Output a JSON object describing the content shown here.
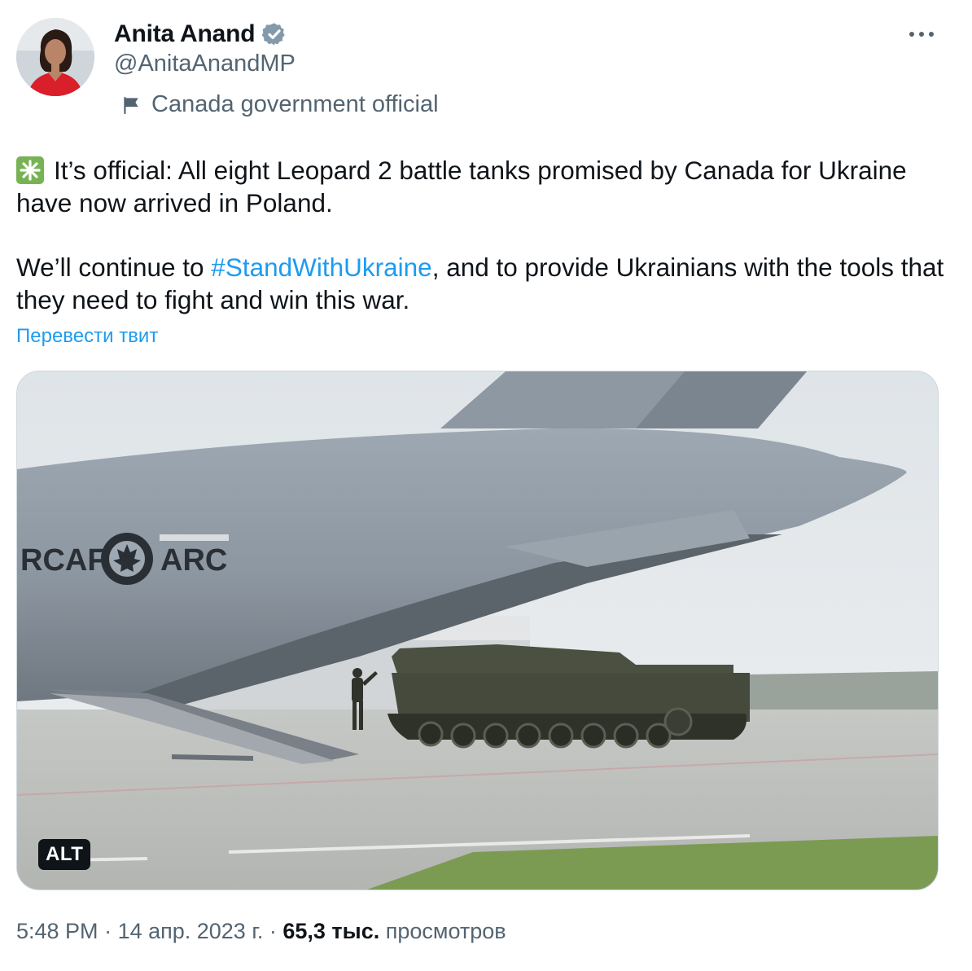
{
  "author": {
    "name": "Anita Anand",
    "handle": "@AnitaAnandMP",
    "label": "Canada government official",
    "verified_icon": "verified-badge-icon",
    "label_icon": "flag-icon"
  },
  "tweet": {
    "line1_text": "It’s official: All eight Leopard 2 battle tanks promised by Canada for Ukraine have now arrived in Poland.",
    "line2_before": "We’ll continue to ",
    "hashtag": "#StandWithUkraine",
    "line2_after": ", and to provide Ukrainians with the tools that they need to fight and win this war.",
    "lead_emoji": "sparkle-icon",
    "translate_label": "Перевести твит"
  },
  "media": {
    "alt_label": "ALT",
    "aircraft_marking_left": "RCAF",
    "aircraft_marking_right": "ARC"
  },
  "meta": {
    "time": "5:48 PM",
    "separator": " · ",
    "date": "14 апр. 2023 г.",
    "views_count": "65,3 тыс.",
    "views_label": "просмотров"
  },
  "colors": {
    "link": "#1d9bf0",
    "secondary_text": "#536471",
    "verified_badge": "#829aab"
  }
}
